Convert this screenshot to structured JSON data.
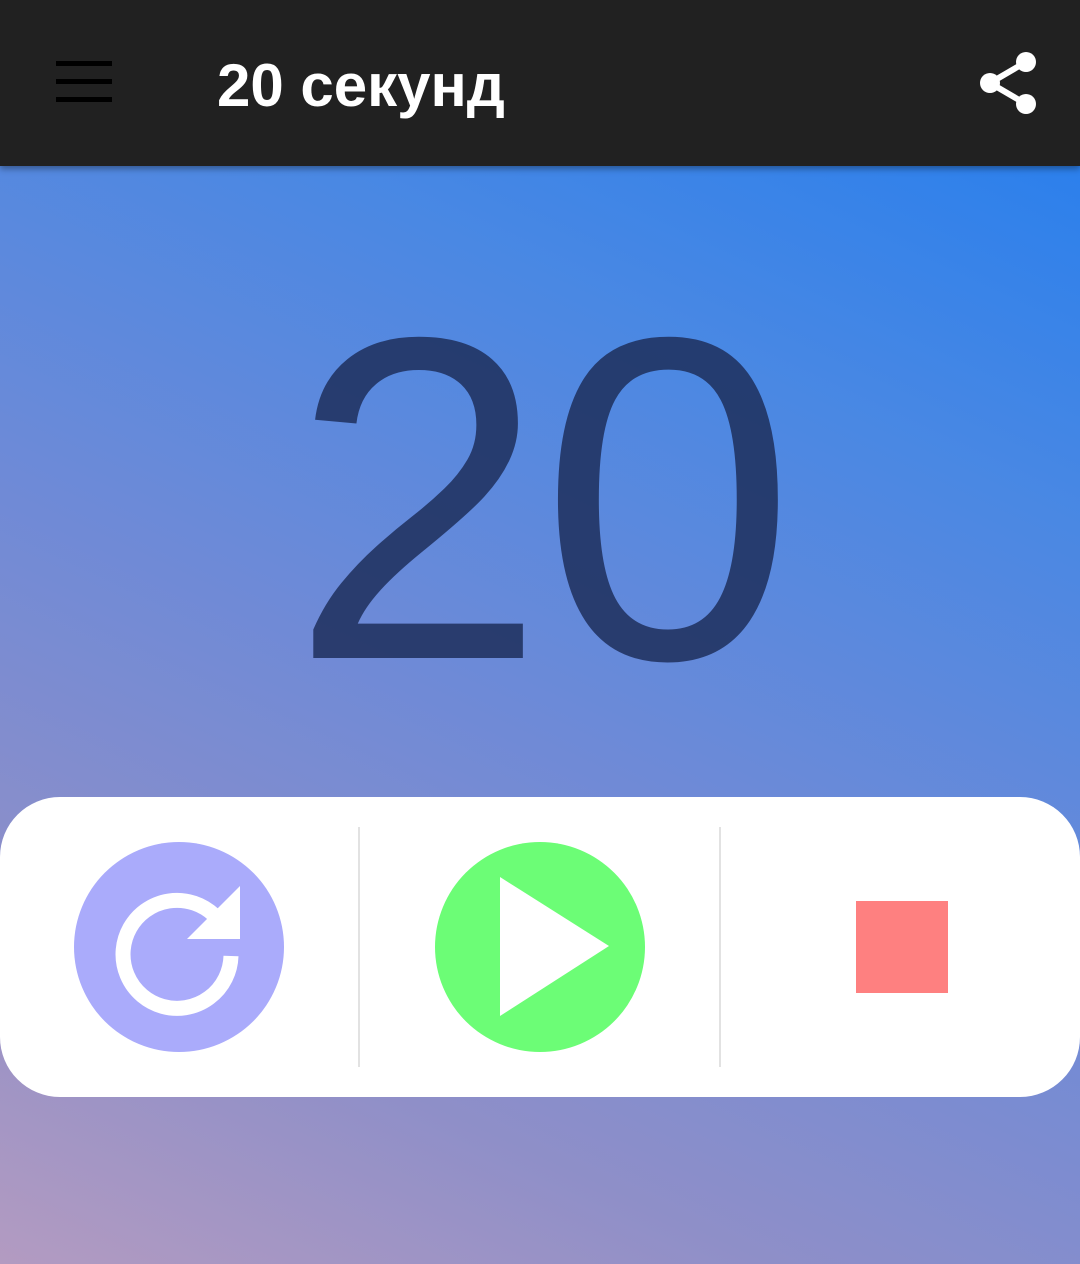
{
  "app_bar": {
    "title": "20 секунд",
    "menu_icon": "hamburger-menu-icon",
    "share_icon": "share-icon"
  },
  "timer": {
    "value": "20"
  },
  "controls": {
    "reset": {
      "icon": "restart-icon",
      "color": "#aaabfb"
    },
    "play": {
      "icon": "play-icon",
      "color": "#6cfd76"
    },
    "stop": {
      "icon": "stop-icon",
      "color": "#fe8080"
    }
  },
  "colors": {
    "app_bar": "#212121",
    "counter_text": "#1e2f5c",
    "gradient_top": "#1e7cf0",
    "gradient_bottom": "#b39bc1"
  }
}
